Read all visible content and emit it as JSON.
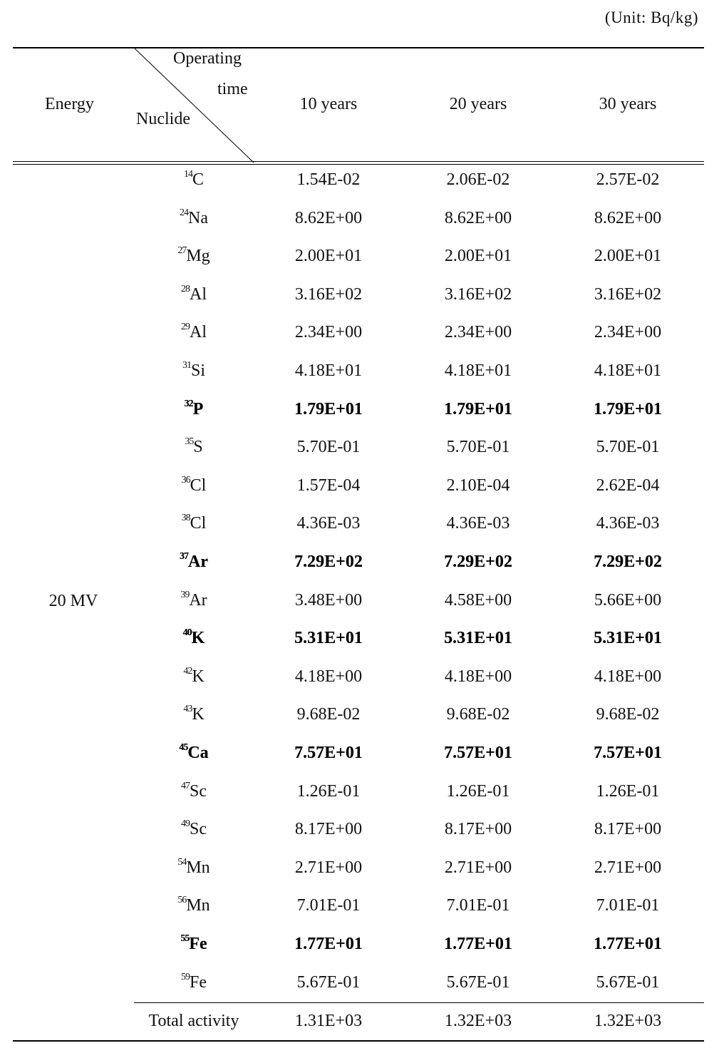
{
  "unit_label": "(Unit: Bq/kg)",
  "header": {
    "energy": "Energy",
    "operating": "Operating",
    "time": "time",
    "nuclide": "Nuclide",
    "columns": [
      "10 years",
      "20 years",
      "30 years"
    ]
  },
  "energy_value": "20 MV",
  "rows": [
    {
      "mass": "14",
      "element": "C",
      "values": [
        "1.54E-02",
        "2.06E-02",
        "2.57E-02"
      ],
      "emphasized": false
    },
    {
      "mass": "24",
      "element": "Na",
      "values": [
        "8.62E+00",
        "8.62E+00",
        "8.62E+00"
      ],
      "emphasized": false
    },
    {
      "mass": "27",
      "element": "Mg",
      "values": [
        "2.00E+01",
        "2.00E+01",
        "2.00E+01"
      ],
      "emphasized": false
    },
    {
      "mass": "28",
      "element": "Al",
      "values": [
        "3.16E+02",
        "3.16E+02",
        "3.16E+02"
      ],
      "emphasized": false
    },
    {
      "mass": "29",
      "element": "Al",
      "values": [
        "2.34E+00",
        "2.34E+00",
        "2.34E+00"
      ],
      "emphasized": false
    },
    {
      "mass": "31",
      "element": "Si",
      "values": [
        "4.18E+01",
        "4.18E+01",
        "4.18E+01"
      ],
      "emphasized": false
    },
    {
      "mass": "32",
      "element": "P",
      "values": [
        "1.79E+01",
        "1.79E+01",
        "1.79E+01"
      ],
      "emphasized": true
    },
    {
      "mass": "35",
      "element": "S",
      "values": [
        "5.70E-01",
        "5.70E-01",
        "5.70E-01"
      ],
      "emphasized": false
    },
    {
      "mass": "36",
      "element": "Cl",
      "values": [
        "1.57E-04",
        "2.10E-04",
        "2.62E-04"
      ],
      "emphasized": false
    },
    {
      "mass": "38",
      "element": "Cl",
      "values": [
        "4.36E-03",
        "4.36E-03",
        "4.36E-03"
      ],
      "emphasized": false
    },
    {
      "mass": "37",
      "element": "Ar",
      "values": [
        "7.29E+02",
        "7.29E+02",
        "7.29E+02"
      ],
      "emphasized": true
    },
    {
      "mass": "39",
      "element": "Ar",
      "values": [
        "3.48E+00",
        "4.58E+00",
        "5.66E+00"
      ],
      "emphasized": false
    },
    {
      "mass": "40",
      "element": "K",
      "values": [
        "5.31E+01",
        "5.31E+01",
        "5.31E+01"
      ],
      "emphasized": true
    },
    {
      "mass": "42",
      "element": "K",
      "values": [
        "4.18E+00",
        "4.18E+00",
        "4.18E+00"
      ],
      "emphasized": false
    },
    {
      "mass": "43",
      "element": "K",
      "values": [
        "9.68E-02",
        "9.68E-02",
        "9.68E-02"
      ],
      "emphasized": false
    },
    {
      "mass": "45",
      "element": "Ca",
      "values": [
        "7.57E+01",
        "7.57E+01",
        "7.57E+01"
      ],
      "emphasized": true
    },
    {
      "mass": "47",
      "element": "Sc",
      "values": [
        "1.26E-01",
        "1.26E-01",
        "1.26E-01"
      ],
      "emphasized": false
    },
    {
      "mass": "49",
      "element": "Sc",
      "values": [
        "8.17E+00",
        "8.17E+00",
        "8.17E+00"
      ],
      "emphasized": false
    },
    {
      "mass": "54",
      "element": "Mn",
      "values": [
        "2.71E+00",
        "2.71E+00",
        "2.71E+00"
      ],
      "emphasized": false
    },
    {
      "mass": "56",
      "element": "Mn",
      "values": [
        "7.01E-01",
        "7.01E-01",
        "7.01E-01"
      ],
      "emphasized": false
    },
    {
      "mass": "55",
      "element": "Fe",
      "values": [
        "1.77E+01",
        "1.77E+01",
        "1.77E+01"
      ],
      "emphasized": true
    },
    {
      "mass": "59",
      "element": "Fe",
      "values": [
        "5.67E-01",
        "5.67E-01",
        "5.67E-01"
      ],
      "emphasized": false
    }
  ],
  "total": {
    "label": "Total activity",
    "values": [
      "1.31E+03",
      "1.32E+03",
      "1.32E+03"
    ]
  }
}
